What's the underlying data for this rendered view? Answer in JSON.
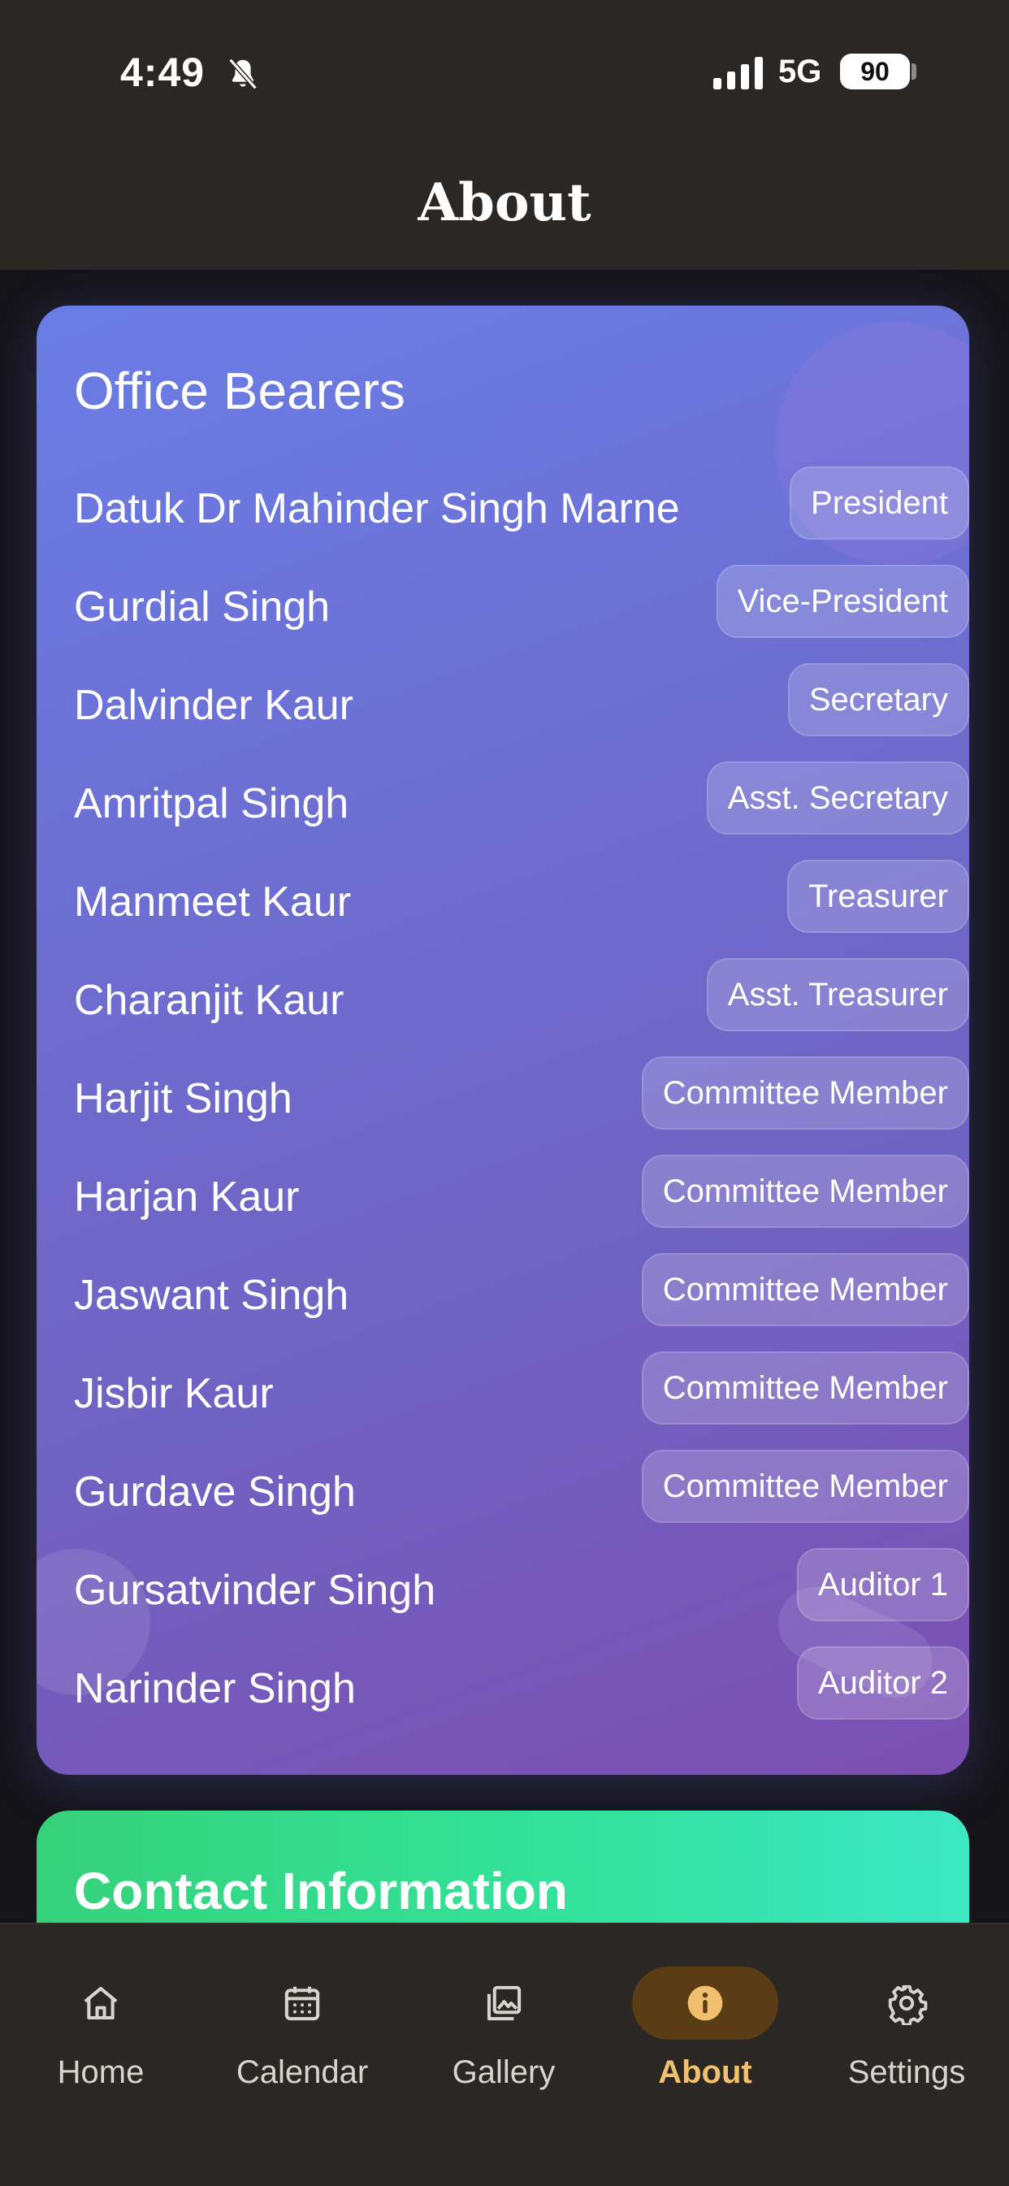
{
  "status_bar": {
    "time": "4:49",
    "network": "5G",
    "battery": "90"
  },
  "header": {
    "title": "About"
  },
  "office_bearers": {
    "title": "Office Bearers",
    "members": [
      {
        "name": "Datuk Dr Mahinder Singh Marne",
        "role": "President"
      },
      {
        "name": "Gurdial Singh",
        "role": "Vice-President"
      },
      {
        "name": "Dalvinder Kaur",
        "role": "Secretary"
      },
      {
        "name": "Amritpal Singh",
        "role": "Asst. Secretary"
      },
      {
        "name": "Manmeet Kaur",
        "role": "Treasurer"
      },
      {
        "name": "Charanjit Kaur",
        "role": "Asst. Treasurer"
      },
      {
        "name": "Harjit Singh",
        "role": "Committee Member"
      },
      {
        "name": "Harjan Kaur",
        "role": "Committee Member"
      },
      {
        "name": "Jaswant Singh",
        "role": "Committee Member"
      },
      {
        "name": "Jisbir Kaur",
        "role": "Committee Member"
      },
      {
        "name": "Gurdave Singh",
        "role": "Committee Member"
      },
      {
        "name": "Gursatvinder Singh",
        "role": "Auditor 1"
      },
      {
        "name": "Narinder Singh",
        "role": "Auditor 2"
      }
    ]
  },
  "contact": {
    "title": "Contact Information"
  },
  "bottom_nav": {
    "items": [
      {
        "label": "Home",
        "icon": "home-icon"
      },
      {
        "label": "Calendar",
        "icon": "calendar-icon"
      },
      {
        "label": "Gallery",
        "icon": "gallery-icon"
      },
      {
        "label": "About",
        "icon": "info-icon",
        "active": true
      },
      {
        "label": "Settings",
        "icon": "gear-icon"
      }
    ],
    "active_color": "#f0c06e",
    "active_pill_color": "#5b3d15"
  },
  "colors": {
    "header_bg": "#2a2724",
    "page_bg": "#151419",
    "officers_gradient_start": "#6a7de6",
    "officers_gradient_end": "#7c4fb2",
    "contact_gradient_start": "#36d27a",
    "contact_gradient_end": "#3ce7c4"
  }
}
